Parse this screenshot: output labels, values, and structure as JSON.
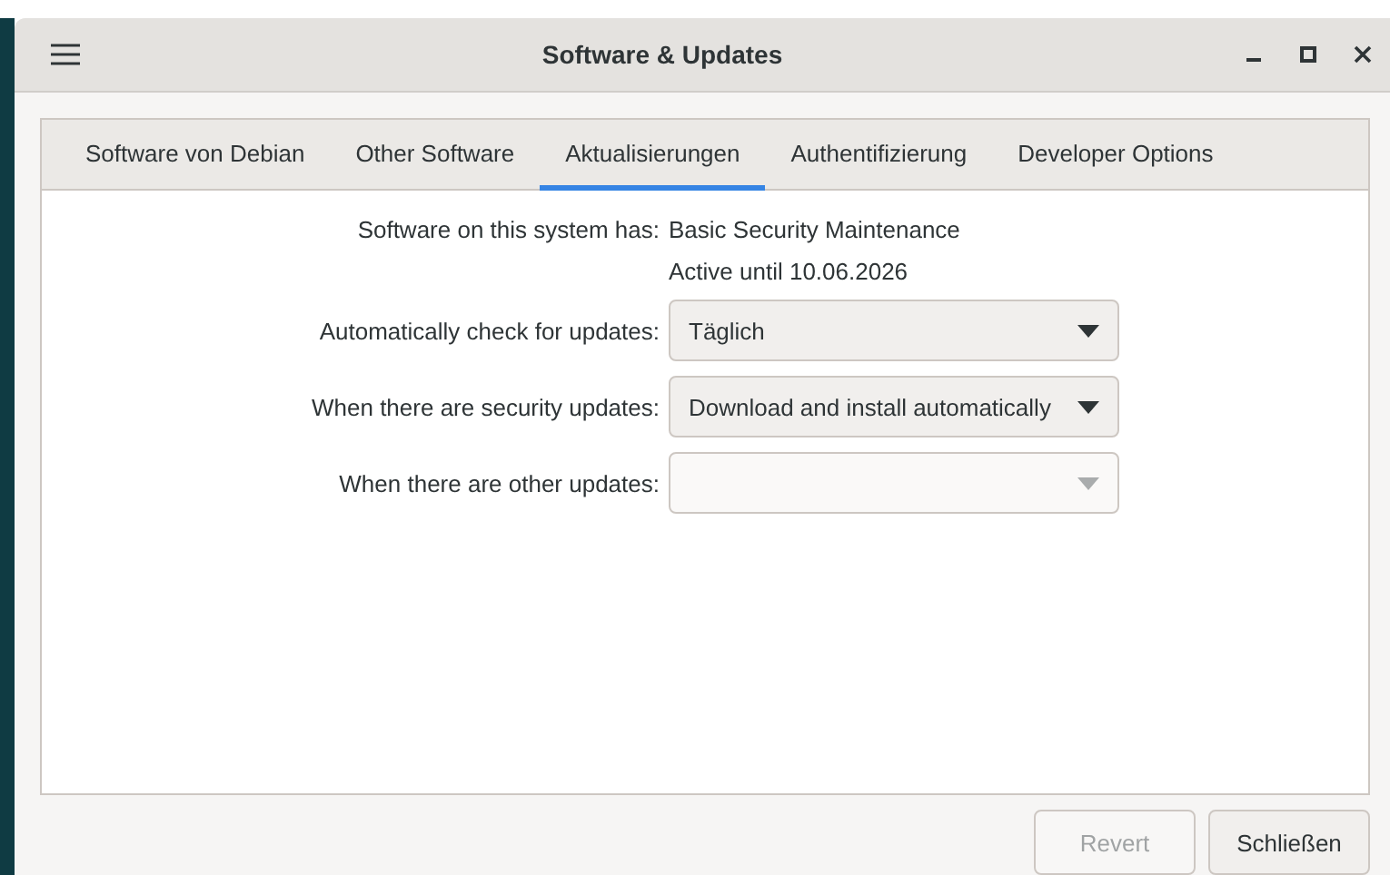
{
  "window": {
    "title": "Software & Updates"
  },
  "tabs": [
    {
      "label": "Software von Debian",
      "selected": false
    },
    {
      "label": "Other Software",
      "selected": false
    },
    {
      "label": "Aktualisierungen",
      "selected": true
    },
    {
      "label": "Authentifizierung",
      "selected": false
    },
    {
      "label": "Developer Options",
      "selected": false
    }
  ],
  "support": {
    "label": "Software on this system has:",
    "value": "Basic Security Maintenance",
    "until": "Active until 10.06.2026"
  },
  "settings": [
    {
      "label": "Automatically check for updates:",
      "value": "Täglich",
      "disabled": false
    },
    {
      "label": "When there are security updates:",
      "value": "Download and install automatically",
      "disabled": false
    },
    {
      "label": "When there are other updates:",
      "disabled": true
    }
  ],
  "buttons": [
    {
      "label": "Revert",
      "disabled": true
    },
    {
      "label": "Schließen",
      "disabled": false
    }
  ]
}
